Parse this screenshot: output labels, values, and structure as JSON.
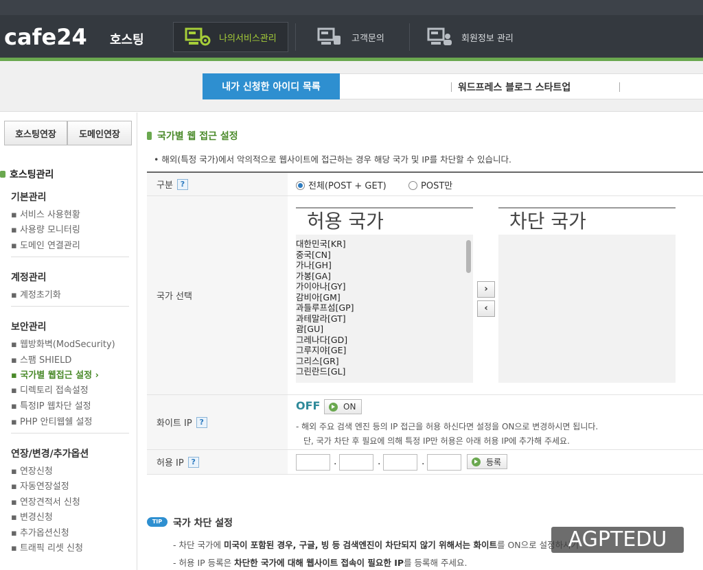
{
  "header": {
    "logo": "cafe24",
    "logo_sub": "호스팅",
    "nav": [
      {
        "label": "나의서비스관리",
        "icon": "server-gear-icon"
      },
      {
        "label": "고객문의",
        "icon": "server-phone-icon"
      },
      {
        "label": "회원정보 관리",
        "icon": "server-user-icon"
      }
    ]
  },
  "tabs": {
    "active": "내가 신청한 아이디 목록",
    "other": "워드프레스 블로그 스타트업"
  },
  "sidebar": {
    "buttons": [
      "호스팅연장",
      "도메인연장"
    ],
    "section": "호스팅관리",
    "groups": [
      {
        "title": "기본관리",
        "items": [
          "서비스 사용현황",
          "사용량 모니터링",
          "도메인 연결관리"
        ]
      },
      {
        "title": "계정관리",
        "items": [
          "계정초기화"
        ]
      },
      {
        "title": "보안관리",
        "items": [
          "웹방화벽(ModSecurity)",
          "스팸 SHIELD",
          "국가별 웹접근 설정",
          "디렉토리 접속설정",
          "특정IP 웹차단 설정",
          "PHP 안티웹쉘 설정"
        ]
      },
      {
        "title": "연장/변경/추가옵션",
        "items": [
          "연장신청",
          "자동연장설정",
          "연장견적서 신청",
          "변경신청",
          "추가옵션신청",
          "트래픽 리셋 신청"
        ]
      }
    ],
    "active_item": "국가별 웹접근 설정"
  },
  "main": {
    "title": "국가별 웹 접근 설정",
    "description": "해외(특정 국가)에서 악의적으로 웹사이트에 접근하는 경우 해당 국가 및 IP를 차단할 수 있습니다.",
    "type_label": "구분",
    "radio_all": "전체(POST + GET)",
    "radio_post": "POST만",
    "country_label": "국가 선택",
    "allowed_head": "허용 국가",
    "blocked_head": "차단 국가",
    "countries": [
      "대한민국[KR]",
      "중국[CN]",
      "가나[GH]",
      "가봉[GA]",
      "가이아나[GY]",
      "감비아[GM]",
      "과들루프섬[GP]",
      "과테말라[GT]",
      "괌[GU]",
      "그레나다[GD]",
      "그루지야[GE]",
      "그리스[GR]",
      "그린란드[GL]"
    ],
    "move_right": "›",
    "move_left": "‹",
    "whiteip_label": "화이트 IP",
    "off_text": "OFF",
    "on_btn": "ON",
    "whiteip_note1": "- 해외 주요 검색 엔진 등의 IP 접근을 허용 하신다면 설정을 ON으로 변경하시면 됩니다.",
    "whiteip_note2": "단, 국가 차단 후 필요에 의해 특정 IP만 허용은 아래 허용 IP에 추가해 주세요.",
    "allowip_label": "허용 IP",
    "register_btn": "등록",
    "help": "?"
  },
  "tip": {
    "badge": "TIP",
    "title": "국가 차단 설정",
    "line1_pre": "- 차단 국가에 ",
    "line1_bold": "미국이 포함된 경우, 구글, 빙 등 검색엔진이 차단되지 않기 위해서는 화이트",
    "line1_post": "를 ON으로 설정하시기",
    "line2_pre": "- 허용 IP 등록은 ",
    "line2_bold": "차단한 국가에 대해 웹사이트 접속이 필요한 IP",
    "line2_post": "를 등록해 주세요."
  },
  "watermark": "AGPTEDU"
}
